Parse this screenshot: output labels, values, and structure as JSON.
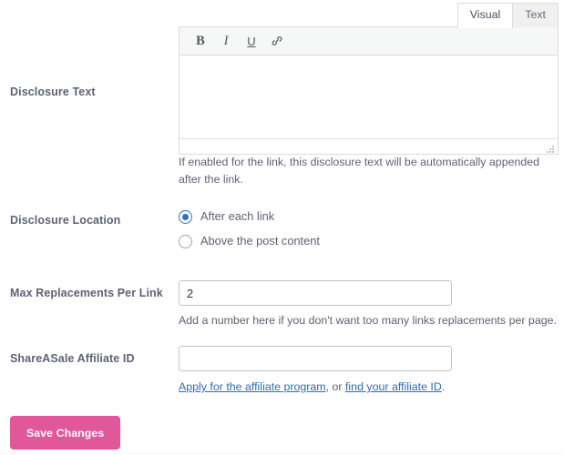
{
  "form": {
    "rows": [
      {
        "label": "Disclosure Text",
        "help": "If enabled for the link, this disclosure text will be automatically appended after the link."
      },
      {
        "label": "Disclosure Location"
      },
      {
        "label": "Max Replacements Per Link",
        "help": "Add a number here if you don't want too many links replacements per page."
      },
      {
        "label": "ShareASale Affiliate ID"
      }
    ]
  },
  "editor": {
    "tabs": [
      {
        "label": "Visual",
        "active": true
      },
      {
        "label": "Text",
        "active": false
      }
    ],
    "toolbar": [
      {
        "name": "bold-icon",
        "glyph": "B"
      },
      {
        "name": "italic-icon",
        "glyph": "I"
      },
      {
        "name": "underline-icon",
        "glyph": "U"
      },
      {
        "name": "link-icon",
        "glyph": "link"
      }
    ],
    "content": "",
    "resize_handle": "resize-grip"
  },
  "disclosure_location": {
    "options": [
      {
        "label": "After each link",
        "selected": true
      },
      {
        "label": "Above the post content",
        "selected": false
      }
    ]
  },
  "max_replacements": {
    "value": "2",
    "placeholder": ""
  },
  "shareasale": {
    "value": "",
    "placeholder": "",
    "link_prefix": "",
    "link1": "Apply for the affiliate program",
    "link_middle": ", or ",
    "link2": "find your affiliate ID",
    "link_suffix": "."
  },
  "actions": {
    "save_label": "Save Changes"
  },
  "colors": {
    "accent_pink": "#e0579a",
    "radio_blue": "#2b72c4",
    "link_blue": "#2b6cb8",
    "label_gray": "#5d6275",
    "border_gray": "#dcdcde"
  }
}
